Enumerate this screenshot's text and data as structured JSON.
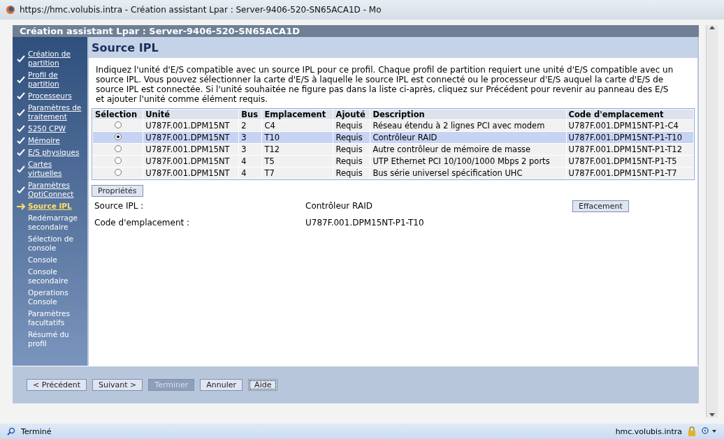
{
  "browser": {
    "title": "https://hmc.volubis.intra - Création assistant Lpar : Server-9406-520-SN65ACA1D - Mo"
  },
  "wizard": {
    "title": "Création assistant Lpar : Server-9406-520-SN65ACA1D"
  },
  "sidebar": {
    "items": [
      {
        "label": "Création de partition",
        "kind": "done"
      },
      {
        "label": "Profil de partition",
        "kind": "done"
      },
      {
        "label": "Processeurs",
        "kind": "done"
      },
      {
        "label": "Paramètres de traitement",
        "kind": "done"
      },
      {
        "label": "5250 CPW",
        "kind": "done"
      },
      {
        "label": "Mémoire",
        "kind": "done"
      },
      {
        "label": "E/S physiques",
        "kind": "done"
      },
      {
        "label": "Cartes virtuelles",
        "kind": "done"
      },
      {
        "label": "Paramètres OptiConnect",
        "kind": "done"
      },
      {
        "label": "Source IPL",
        "kind": "current"
      },
      {
        "label": "Redémarrage secondaire",
        "kind": "todo"
      },
      {
        "label": "Sélection de console",
        "kind": "todo"
      },
      {
        "label": "Console",
        "kind": "todo"
      },
      {
        "label": "Console secondaire",
        "kind": "todo"
      },
      {
        "label": "Operations Console",
        "kind": "todo"
      },
      {
        "label": "Paramètres facultatifs",
        "kind": "todo"
      },
      {
        "label": "Résumé du profil",
        "kind": "todo"
      }
    ]
  },
  "panel": {
    "title": "Source IPL",
    "intro": "Indiquez l'unité d'E/S compatible avec un source IPL pour ce profil. Chaque profil de partition requiert une unité d'E/S compatible avec un source IPL. Vous pouvez sélectionner la carte d'E/S à laquelle le source IPL est connecté ou le processeur d'E/S auquel la carte d'E/S de source IPL est connectée. Si l'unité souhaitée ne figure pas dans la liste ci-après, cliquez sur Précédent pour revenir au panneau des E/S et ajouter l'unité comme élément requis."
  },
  "table": {
    "columns": [
      "Sélection",
      "Unité",
      "Bus",
      "Emplacement",
      "Ajouté",
      "Description",
      "Code d'emplacement"
    ],
    "rows": [
      {
        "selected": false,
        "cells": [
          "",
          "U787F.001.DPM15NT",
          "2",
          "C4",
          "Requis",
          "Réseau étendu à 2 lignes PCI avec modem",
          "U787F.001.DPM15NT-P1-C4"
        ]
      },
      {
        "selected": true,
        "cells": [
          "",
          "U787F.001.DPM15NT",
          "3",
          "T10",
          "Requis",
          "Contrôleur RAID",
          "U787F.001.DPM15NT-P1-T10"
        ]
      },
      {
        "selected": false,
        "cells": [
          "",
          "U787F.001.DPM15NT",
          "3",
          "T12",
          "Requis",
          "Autre contrôleur de mémoire de masse",
          "U787F.001.DPM15NT-P1-T12"
        ]
      },
      {
        "selected": false,
        "cells": [
          "",
          "U787F.001.DPM15NT",
          "4",
          "T5",
          "Requis",
          "UTP Ethernet PCI 10/100/1000 Mbps 2 ports",
          "U787F.001.DPM15NT-P1-T5"
        ]
      },
      {
        "selected": false,
        "cells": [
          "",
          "U787F.001.DPM15NT",
          "4",
          "T7",
          "Requis",
          "Bus série universel spécification UHC",
          "U787F.001.DPM15NT-P1-T7"
        ]
      }
    ]
  },
  "properties_button": "Propriétés",
  "summary": [
    {
      "label": "Source IPL :",
      "value": "Contrôleur RAID",
      "action": "Effacement"
    },
    {
      "label": "Code d'emplacement :",
      "value": "U787F.001.DPM15NT-P1-T10"
    }
  ],
  "buttons": [
    {
      "label": "< Précédent",
      "disabled": false,
      "focused": false
    },
    {
      "label": "Suivant >",
      "disabled": false,
      "focused": false
    },
    {
      "label": "Terminer",
      "disabled": true,
      "focused": false
    },
    {
      "label": "Annuler",
      "disabled": false,
      "focused": false
    },
    {
      "label": "Aide",
      "disabled": false,
      "focused": true
    }
  ],
  "status_bar": {
    "status": "Terminé",
    "host": "hmc.volubis.intra"
  }
}
